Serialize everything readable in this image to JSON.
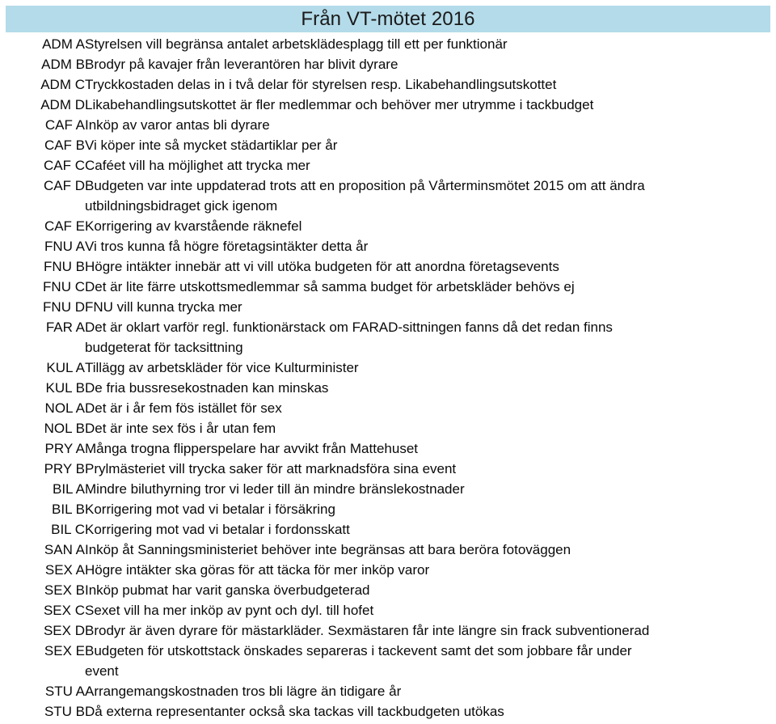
{
  "document": {
    "title": "Från VT-mötet 2016",
    "header_color": "#b4dbe9",
    "text_color": "#0a0a0a",
    "background_color": "#ffffff"
  },
  "table": {
    "rows": [
      {
        "code": "ADM A",
        "text": "Styrelsen vill begränsa antalet arbetsklädesplagg till ett per funktionär",
        "continuation": false
      },
      {
        "code": "ADM B",
        "text": "Brodyr på kavajer från leverantören har blivit dyrare",
        "continuation": false
      },
      {
        "code": "ADM C",
        "text": "Tryckkostaden delas in i två delar för styrelsen resp. Likabehandlingsutskottet",
        "continuation": false
      },
      {
        "code": "ADM D",
        "text": "Likabehandlingsutskottet är fler medlemmar och behöver mer utrymme i tackbudget",
        "continuation": false
      },
      {
        "code": "CAF A",
        "text": "Inköp av varor antas bli dyrare",
        "continuation": false
      },
      {
        "code": "CAF B",
        "text": "Vi köper inte så mycket städartiklar per år",
        "continuation": false
      },
      {
        "code": "CAF C",
        "text": "Caféet vill ha möjlighet att trycka mer",
        "continuation": false
      },
      {
        "code": "CAF D",
        "text": "Budgeten var inte uppdaterad trots att en proposition på Vårterminsmötet 2015 om att ändra",
        "continuation": false
      },
      {
        "code": "",
        "text": "utbildningsbidraget gick igenom",
        "continuation": true
      },
      {
        "code": "CAF E",
        "text": "Korrigering av kvarstående räknefel",
        "continuation": false
      },
      {
        "code": "FNU A",
        "text": "Vi tros kunna få högre företagsintäkter detta år",
        "continuation": false
      },
      {
        "code": "FNU B",
        "text": "Högre intäkter innebär att vi vill utöka budgeten för att anordna företagsevents",
        "continuation": false
      },
      {
        "code": "FNU C",
        "text": "Det är lite färre utskottsmedlemmar så samma budget för arbetskläder behövs ej",
        "continuation": false
      },
      {
        "code": "FNU D",
        "text": "FNU vill kunna trycka mer",
        "continuation": false
      },
      {
        "code": "FAR A",
        "text": "Det är oklart varför regl. funktionärstack om FARAD-sittningen fanns då det redan finns",
        "continuation": false
      },
      {
        "code": "",
        "text": "budgeterat för tacksittning",
        "continuation": true
      },
      {
        "code": "KUL A",
        "text": "Tillägg av arbetskläder för vice Kulturminister",
        "continuation": false
      },
      {
        "code": "KUL B",
        "text": "De fria bussresekostnaden kan minskas",
        "continuation": false
      },
      {
        "code": "NOL A",
        "text": "Det är i år fem fös istället för sex",
        "continuation": false
      },
      {
        "code": "NOL B",
        "text": "Det är inte sex fös i år utan fem",
        "continuation": false
      },
      {
        "code": "PRY A",
        "text": "Många trogna flipperspelare har avvikt från Mattehuset",
        "continuation": false
      },
      {
        "code": "PRY B",
        "text": "Prylmästeriet vill trycka saker för att marknadsföra sina event",
        "continuation": false
      },
      {
        "code": "BIL A",
        "text": "Mindre biluthyrning tror vi leder till än mindre bränslekostnader",
        "continuation": false
      },
      {
        "code": "BIL B",
        "text": "Korrigering mot vad vi betalar i försäkring",
        "continuation": false
      },
      {
        "code": "BIL C",
        "text": "Korrigering mot vad vi betalar i fordonsskatt",
        "continuation": false
      },
      {
        "code": "SAN A",
        "text": "Inköp åt Sanningsministeriet behöver inte begränsas att bara beröra fotoväggen",
        "continuation": false
      },
      {
        "code": "SEX A",
        "text": "Högre intäkter ska göras för att täcka för mer inköp varor",
        "continuation": false
      },
      {
        "code": "SEX B",
        "text": "Inköp pubmat har varit ganska överbudgeterad",
        "continuation": false
      },
      {
        "code": "SEX C",
        "text": "Sexet vill ha mer inköp av pynt och dyl. till hofet",
        "continuation": false
      },
      {
        "code": "SEX D",
        "text": "Brodyr är även dyrare för mästarkläder. Sexmästaren får inte längre sin frack subventionerad",
        "continuation": false
      },
      {
        "code": "SEX E",
        "text": "Budgeten för utskottstack önskades separeras i tackevent samt det som jobbare får under",
        "continuation": false
      },
      {
        "code": "",
        "text": "event",
        "continuation": true
      },
      {
        "code": "STU A",
        "text": "Arrangemangskostnaden tros bli lägre än tidigare år",
        "continuation": false
      },
      {
        "code": "STU B",
        "text": "Då externa representanter också ska tackas vill tackbudgeten utökas",
        "continuation": false
      }
    ]
  }
}
